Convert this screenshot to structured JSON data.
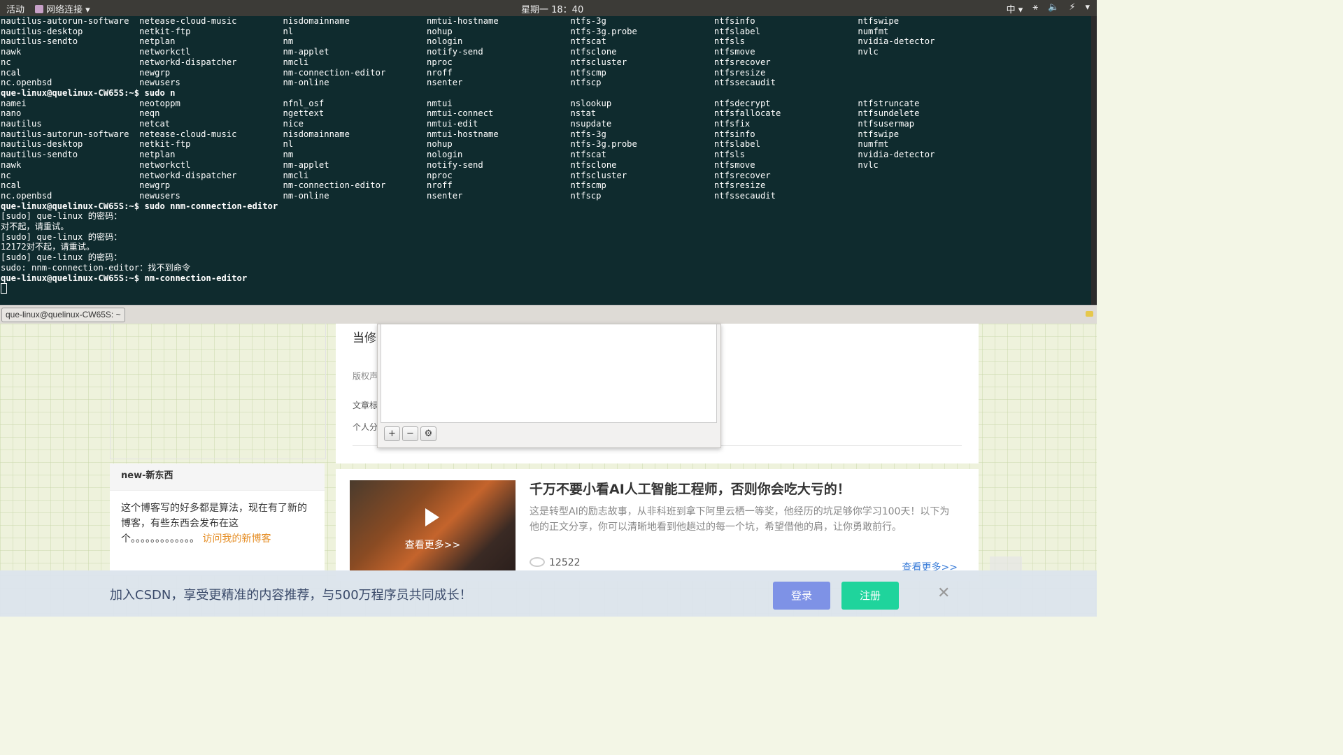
{
  "topbar": {
    "activities": "活动",
    "network": "网络连接 ▾",
    "clock": "星期一 18：40",
    "indicators": [
      "中 ▾",
      "⚹",
      "🔈",
      "⚡",
      "▾"
    ]
  },
  "terminal": {
    "lines": [
      "nautilus-autorun-software  netease-cloud-music         nisdomainname               nmtui-hostname              ntfs-3g                     ntfsinfo                    ntfswipe",
      "nautilus-desktop           netkit-ftp                  nl                          nohup                       ntfs-3g.probe               ntfslabel                   numfmt",
      "nautilus-sendto            netplan                     nm                          nologin                     ntfscat                     ntfsls                      nvidia-detector",
      "nawk                       networkctl                  nm-applet                   notify-send                 ntfsclone                   ntfsmove                    nvlc",
      "nc                         networkd-dispatcher         nmcli                       nproc                       ntfscluster                 ntfsrecover",
      "ncal                       newgrp                      nm-connection-editor        nroff                       ntfscmp                     ntfsresize",
      "nc.openbsd                 newusers                    nm-online                   nsenter                     ntfscp                      ntfssecaudit",
      "que-linux@quelinux-CW65S:~$ sudo n",
      "namei                      neotoppm                    nfnl_osf                    nmtui                       nslookup                    ntfsdecrypt                 ntfstruncate",
      "nano                       neqn                        ngettext                    nmtui-connect               nstat                       ntfsfallocate               ntfsundelete",
      "nautilus                   netcat                      nice                        nmtui-edit                  nsupdate                    ntfsfix                     ntfsusermap",
      "nautilus-autorun-software  netease-cloud-music         nisdomainname               nmtui-hostname              ntfs-3g                     ntfsinfo                    ntfswipe",
      "nautilus-desktop           netkit-ftp                  nl                          nohup                       ntfs-3g.probe               ntfslabel                   numfmt",
      "nautilus-sendto            netplan                     nm                          nologin                     ntfscat                     ntfsls                      nvidia-detector",
      "nawk                       networkctl                  nm-applet                   notify-send                 ntfsclone                   ntfsmove                    nvlc",
      "nc                         networkd-dispatcher         nmcli                       nproc                       ntfscluster                 ntfsrecover",
      "ncal                       newgrp                      nm-connection-editor        nroff                       ntfscmp                     ntfsresize",
      "nc.openbsd                 newusers                    nm-online                   nsenter                     ntfscp                      ntfssecaudit",
      "que-linux@quelinux-CW65S:~$ sudo nnm-connection-editor",
      "[sudo] que-linux 的密码：",
      "对不起，请重试。",
      "[sudo] que-linux 的密码：",
      "12172对不起，请重试。",
      "[sudo] que-linux 的密码：",
      "sudo: nnm-connection-editor：找不到命令",
      "que-linux@quelinux-CW65S:~$ nm-connection-editor",
      ""
    ],
    "tab_title": "que-linux@quelinux-CW65S: ~"
  },
  "webpage": {
    "main": {
      "line1": "当修",
      "line2": "版权声",
      "line3": "文章标",
      "line4": "个人分"
    },
    "dialog": {
      "add": "+",
      "remove": "−",
      "settings": "⚙"
    },
    "new_section": {
      "heading": "new-新东西",
      "text": "这个博客写的好多都是算法，现在有了新的博客，有些东西会发布在这个。。。。。。。。。。。。。",
      "link": "访问我的新博客"
    },
    "article": {
      "title": "千万不要小看AI人工智能工程师，否则你会吃大亏的！",
      "description": "这是转型AI的励志故事，从非科班到拿下阿里云栖一等奖，他经历的坑足够你学习100天！以下为他的正文分享，你可以清晰地看到他趟过的每一个坑，希望借他的肩，让你勇敢前行。",
      "thumb_label": "查看更多>>",
      "views": "12522",
      "more": "查看更多>>"
    },
    "banner": {
      "message": "加入CSDN，享受更精准的内容推荐，与500万程序员共同成长！",
      "login": "登录",
      "register": "注册",
      "close": "✕"
    }
  }
}
